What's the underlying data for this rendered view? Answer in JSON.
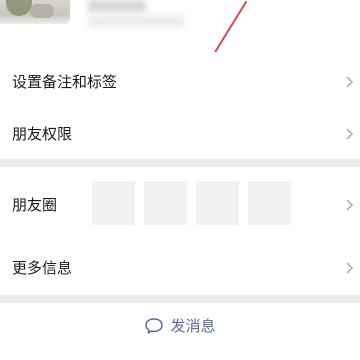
{
  "profile": {
    "name_obscured": true
  },
  "rows": {
    "remarks_tags": "设置备注和标签",
    "friend_permissions": "朋友权限",
    "moments": "朋友圈",
    "more_info": "更多信息"
  },
  "send_message": {
    "label": "发消息"
  },
  "colors": {
    "link": "#576b95",
    "background": "#ededed",
    "annotation": "#e0474c"
  },
  "icons": {
    "chevron": "chevron-right-icon",
    "message": "chat-bubble-icon"
  }
}
